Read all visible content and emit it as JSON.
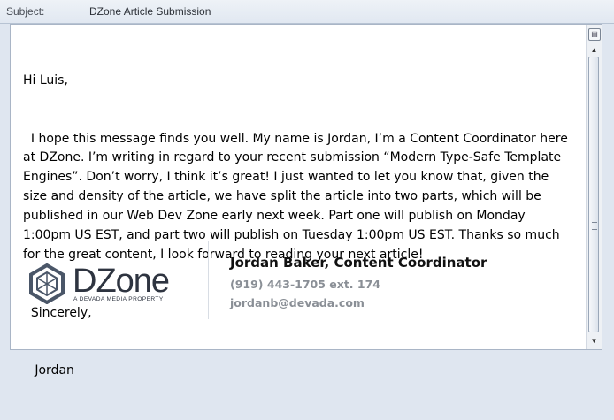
{
  "subject": {
    "label": "Subject:",
    "value": "DZone Article Submission"
  },
  "message": {
    "lines": [
      "Hi Luis,",
      "  I hope this message finds you well. My name is Jordan, I’m a Content Coordinator here at DZone. I’m writing in regard to your recent submission “Modern Type-Safe Template Engines”. Don’t worry, I think it’s great! I just wanted to let you know that, given the size and density of the article, we have split the article into two parts, which will be published in our Web Dev Zone early next week. Part one will publish on Monday 1:00pm US EST, and part two will publish on Tuesday 1:00pm US EST. Thanks so much for the great content, I look forward to reading your next article!",
      "  Sincerely,",
      "   Jordan"
    ]
  },
  "signature": {
    "logo_text": "DZone",
    "logo_tagline": "A DEVADA MEDIA PROPERTY",
    "name_title": "Jordan Baker, Content Coordinator",
    "phone": "(919) 443-1705 ext. 174",
    "email": "jordanb@devada.com"
  },
  "icons": {
    "scroll_top": "page-icon",
    "scroll_up": "arrow-up-icon",
    "scroll_down": "arrow-down-icon"
  }
}
